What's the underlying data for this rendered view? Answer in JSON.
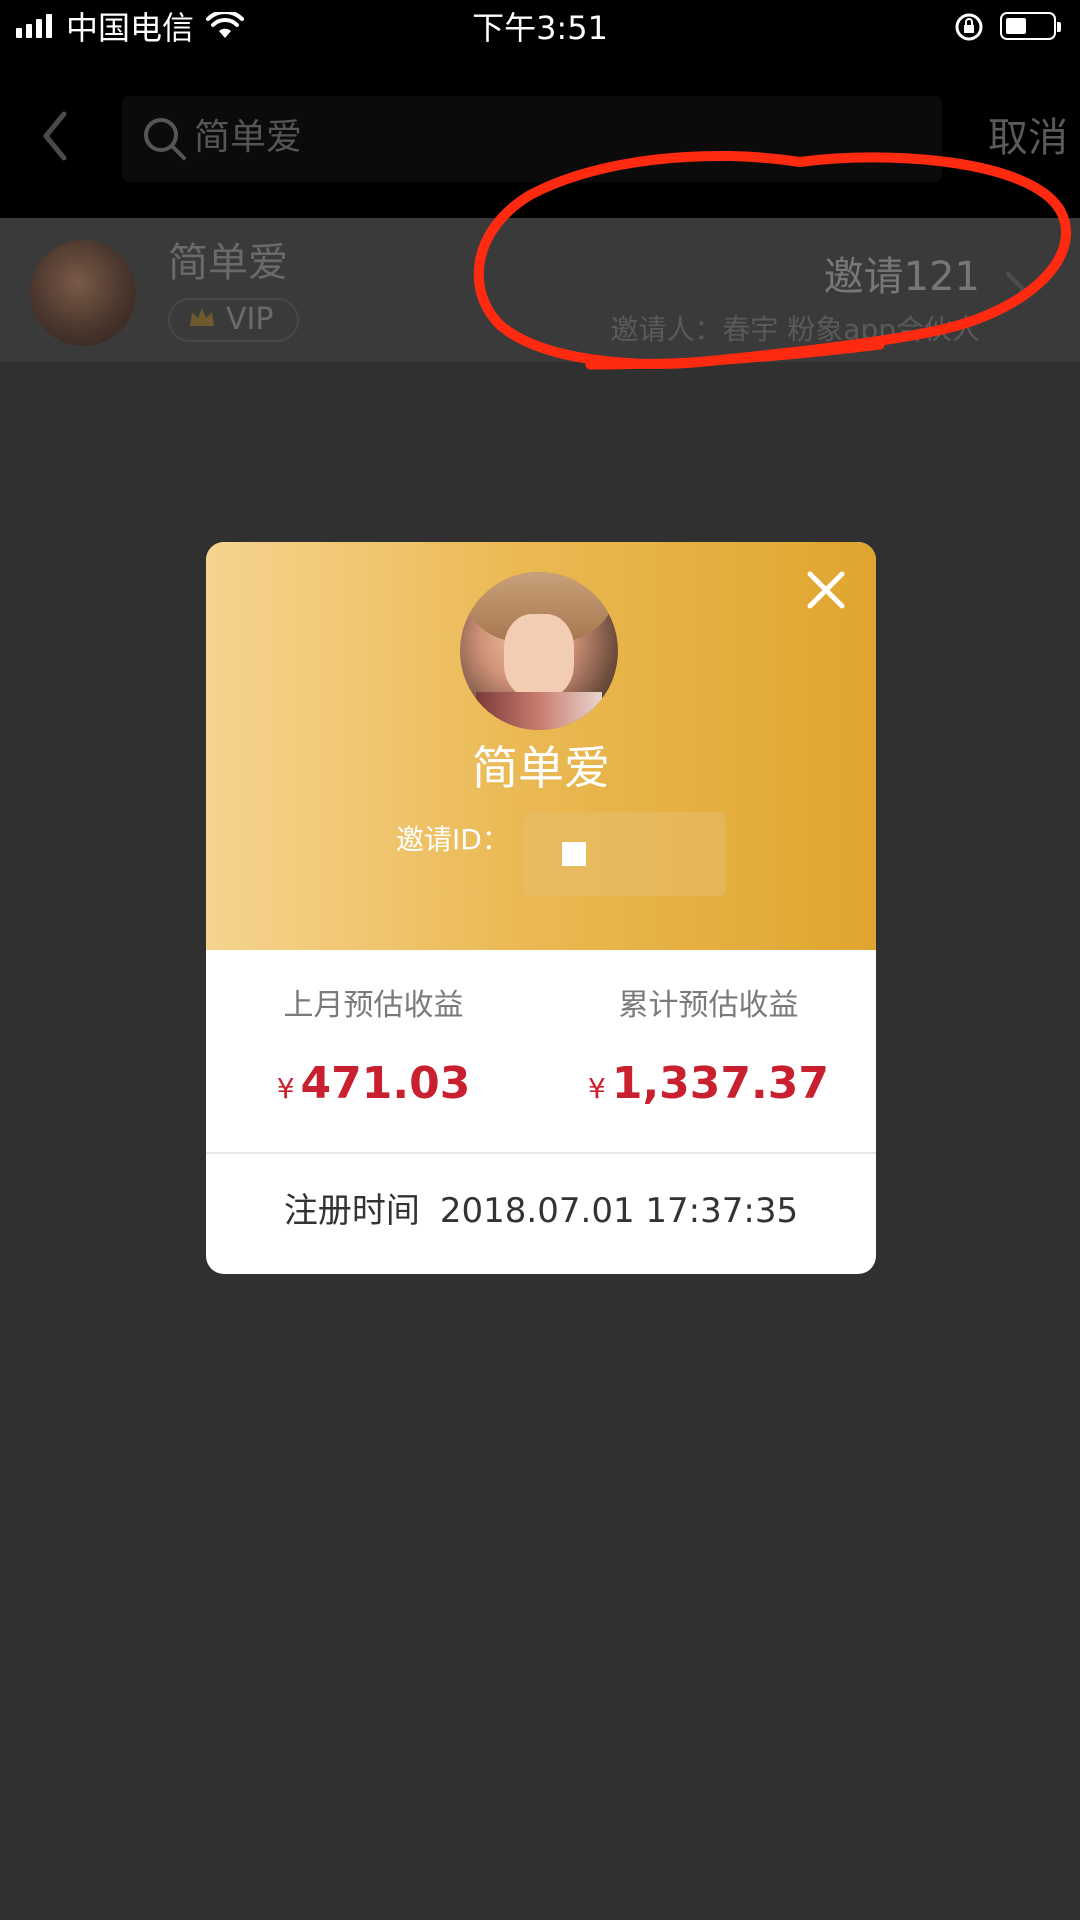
{
  "status_bar": {
    "carrier": "中国电信",
    "time": "下午3:51"
  },
  "nav": {
    "search_text": "简单爱",
    "cancel_label": "取消"
  },
  "result": {
    "name": "简单爱",
    "vip_label": "VIP",
    "invite_count": "邀请121",
    "inviter": "邀请人：春宇 粉象app合伙人"
  },
  "card": {
    "name": "简单爱",
    "invite_id_label": "邀请ID：",
    "last_month_label": "上月预估收益",
    "last_month_value": "471.03",
    "total_label": "累计预估收益",
    "total_value": "1,337.37",
    "currency": "¥",
    "register_label": "注册时间",
    "register_time": "2018.07.01 17:37:35"
  },
  "colors": {
    "accent_red": "#c8202f",
    "gold_start": "#f6d38f",
    "gold_end": "#e0a52e",
    "annotation_red": "#ff2a10"
  },
  "icons": [
    "signal-icon",
    "wifi-icon",
    "rotation-lock-icon",
    "battery-icon",
    "back-icon",
    "search-icon",
    "crown-icon",
    "chevron-right-icon",
    "close-icon"
  ]
}
